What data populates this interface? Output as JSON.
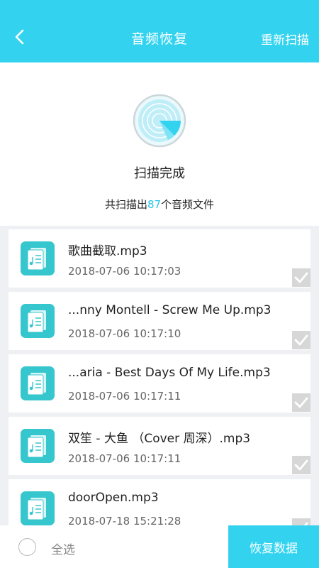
{
  "header": {
    "title": "音频恢复",
    "rescan_label": "重新扫描",
    "back_icon": "chevron-left-icon"
  },
  "summary": {
    "status": "扫描完成",
    "count_prefix": "共扫描出",
    "count": "87",
    "count_suffix": "个音频文件",
    "icon": "radar-scan-icon"
  },
  "files": [
    {
      "name": "歌曲截取.mp3",
      "date": "2018-07-06 10:17:03",
      "checked": true
    },
    {
      "name": "...nny Montell - Screw Me Up.mp3",
      "date": "2018-07-06 10:17:10",
      "checked": true
    },
    {
      "name": "...aria - Best Days Of My Life.mp3",
      "date": "2018-07-06 10:17:11",
      "checked": true
    },
    {
      "name": "双笙 - 大鱼 （Cover 周深）.mp3",
      "date": "2018-07-06 10:17:11",
      "checked": true
    },
    {
      "name": "doorOpen.mp3",
      "date": "2018-07-18 15:21:28",
      "checked": true
    }
  ],
  "bottom": {
    "select_all_label": "全选",
    "recover_label": "恢复数据"
  },
  "colors": {
    "accent": "#33d3f0",
    "file_icon": "#36c6cd",
    "count_highlight": "#2ac6e6"
  }
}
